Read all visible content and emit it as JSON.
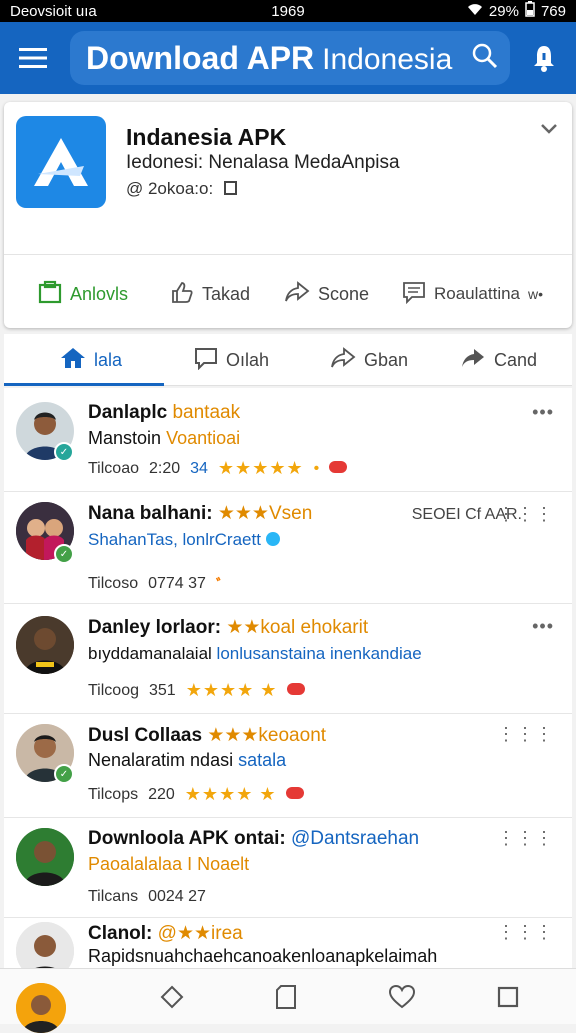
{
  "status_bar": {
    "left": "Deovsioit uıa",
    "time": "1969",
    "battery": "29%",
    "right_extra": "769"
  },
  "app_bar": {
    "search_bold": "Download APR",
    "search_light": "Indonesia"
  },
  "app_card": {
    "name": "Indanesia APK",
    "subtitle": "Iedonesi: Nenalasa MedaAnpisa",
    "meta": "@ 2okoa:o:",
    "actions": [
      {
        "label": "Anlovls",
        "icon": "clipboard-icon",
        "color": "#2e9a2e"
      },
      {
        "label": "Takad",
        "icon": "thumbs-up-icon"
      },
      {
        "label": "Scone",
        "icon": "share-icon"
      },
      {
        "label": "Roaulattina",
        "icon": "comment-icon",
        "suffix": "w•"
      }
    ]
  },
  "tabs": [
    {
      "label": "lala",
      "icon": "home-icon",
      "active": true
    },
    {
      "label": "Oılah",
      "icon": "chat-icon"
    },
    {
      "label": "Gban",
      "icon": "share-icon"
    },
    {
      "label": "Cand",
      "icon": "share-icon"
    }
  ],
  "posts": [
    {
      "name": "Danlaplc",
      "name_accent": "bantaak",
      "line2": "Manstoin",
      "line2_accent": "Voantioai",
      "stats": "Tilcoao",
      "count": "2:20",
      "count2": "34",
      "badge_color": "#26a69a"
    },
    {
      "name": "Nana balhani:",
      "name_accent": "★★★Vsen",
      "line2_blue": "ShahanTas, lonlrCraett",
      "stats": "Tilcoso",
      "count": "0774 37",
      "extra": "SEOEI Cf AAR.",
      "badge_color": "#43a047"
    },
    {
      "name": "Danley lorlaor:",
      "name_accent": "★★koal ehokarit",
      "line2": "bıyddamanalaial",
      "line2_blue": "lonlusanstaina inenkandiae",
      "stats": "Tilcoog",
      "count": "351"
    },
    {
      "name": "Dusl Collaas",
      "name_accent": "★★★keoaont",
      "line2": "Nenalaratim ndasi",
      "line2_blue": "satala",
      "stats": "Tilcops",
      "count": "220",
      "badge_color": "#43a047"
    },
    {
      "name": "Downloola APK ontai:",
      "name_accent_blue": "@Dantsraehan",
      "line2_accent": "Paoalalalaa I Noaelt",
      "stats": "Tilcans",
      "count": "0024 27"
    },
    {
      "name": "Clanol:",
      "name_accent": "@★★irea",
      "line2": "Rapidsnuahchaehcanoakenloanapkelaimah"
    }
  ],
  "colors": {
    "primary": "#1565c0",
    "accent": "#e08a00",
    "star": "#f2a60c",
    "badge_red": "#e53935"
  }
}
